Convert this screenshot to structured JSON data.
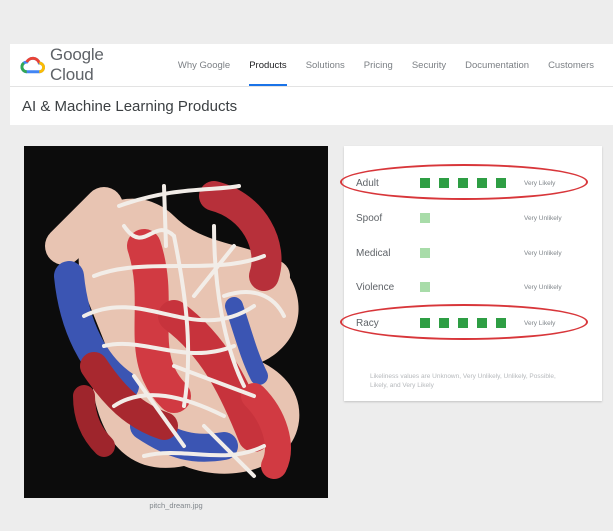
{
  "header": {
    "brand": "Google Cloud",
    "nav": [
      {
        "label": "Why Google",
        "active": false
      },
      {
        "label": "Products",
        "active": true
      },
      {
        "label": "Solutions",
        "active": false
      },
      {
        "label": "Pricing",
        "active": false
      },
      {
        "label": "Security",
        "active": false
      },
      {
        "label": "Documentation",
        "active": false
      },
      {
        "label": "Customers",
        "active": false
      }
    ]
  },
  "page": {
    "title": "AI & Machine Learning Products"
  },
  "image": {
    "caption": "pitch_dream.jpg"
  },
  "results": {
    "rows": [
      {
        "label": "Adult",
        "level": 5,
        "value": "Very Likely",
        "highlighted": true
      },
      {
        "label": "Spoof",
        "level": 1,
        "value": "Very Unlikely",
        "highlighted": false
      },
      {
        "label": "Medical",
        "level": 1,
        "value": "Very Unlikely",
        "highlighted": false
      },
      {
        "label": "Violence",
        "level": 1,
        "value": "Very Unlikely",
        "highlighted": false
      },
      {
        "label": "Racy",
        "level": 5,
        "value": "Very Likely",
        "highlighted": true
      }
    ],
    "note": "Likeliness values are Unknown, Very Unlikely, Unlikely, Possible, Likely, and Very Likely"
  },
  "colors": {
    "bar_full": "#2e9e44",
    "bar_light": "#a8dca9",
    "annotation": "#d8363a",
    "active_tab": "#1a73e8"
  }
}
